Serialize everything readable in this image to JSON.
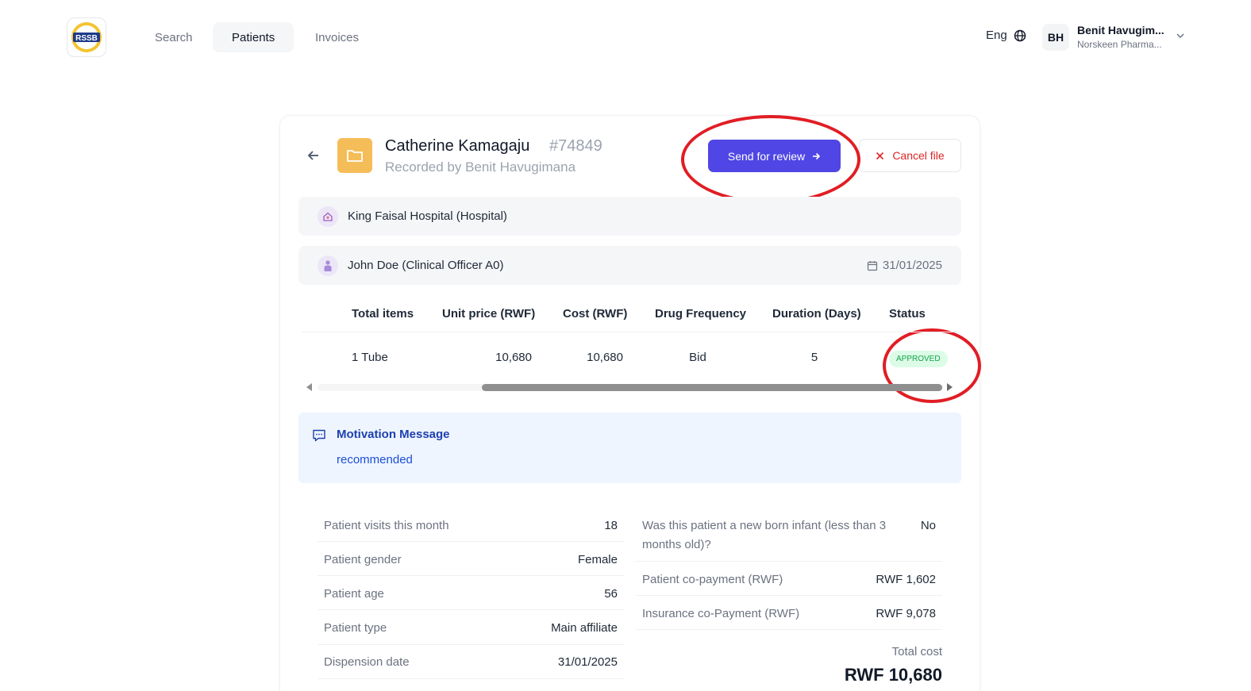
{
  "header": {
    "logo_text": "RSSB",
    "nav": [
      {
        "label": "Search",
        "active": false
      },
      {
        "label": "Patients",
        "active": true
      },
      {
        "label": "Invoices",
        "active": false
      }
    ],
    "language": "Eng",
    "user": {
      "initials": "BH",
      "name": "Benit Havugim...",
      "org": "Norskeen Pharma..."
    }
  },
  "patient": {
    "name": "Catherine Kamagaju",
    "id": "#74849",
    "recorded_by": "Recorded by Benit Havugimana"
  },
  "actions": {
    "send_review": "Send for review",
    "cancel_file": "Cancel file"
  },
  "facility": "King Faisal Hospital (Hospital)",
  "prescriber": "John Doe (Clinical Officer A0)",
  "prescription_date": "31/01/2025",
  "table": {
    "headers": [
      "Total items",
      "Unit price (RWF)",
      "Cost (RWF)",
      "Drug Frequency",
      "Duration (Days)",
      "Status"
    ],
    "rows": [
      {
        "items": "1 Tube",
        "unit_price": "10,680",
        "cost": "10,680",
        "frequency": "Bid",
        "duration": "5",
        "status": "APPROVED"
      }
    ]
  },
  "motivation": {
    "title": "Motivation Message",
    "text": "recommended"
  },
  "details_left": [
    {
      "label": "Patient visits this month",
      "value": "18"
    },
    {
      "label": "Patient gender",
      "value": "Female"
    },
    {
      "label": "Patient age",
      "value": "56"
    },
    {
      "label": "Patient type",
      "value": "Main affiliate"
    },
    {
      "label": "Dispension date",
      "value": "31/01/2025"
    }
  ],
  "details_right": {
    "newborn_q_line1": "Was this patient a new born infant (less than 3",
    "newborn_q_line2": "months old)?",
    "newborn_a": "No",
    "copay_label": "Patient co-payment (RWF)",
    "copay_value": "RWF 1,602",
    "ins_label": "Insurance co-Payment (RWF)",
    "ins_value": "RWF 9,078",
    "total_label": "Total cost",
    "total_value": "RWF 10,680"
  },
  "colors": {
    "primary": "#4f46e5",
    "danger": "#dc2626",
    "approved_bg": "#dcfce7",
    "approved_text": "#16a34a",
    "annotation": "#e11d24"
  }
}
